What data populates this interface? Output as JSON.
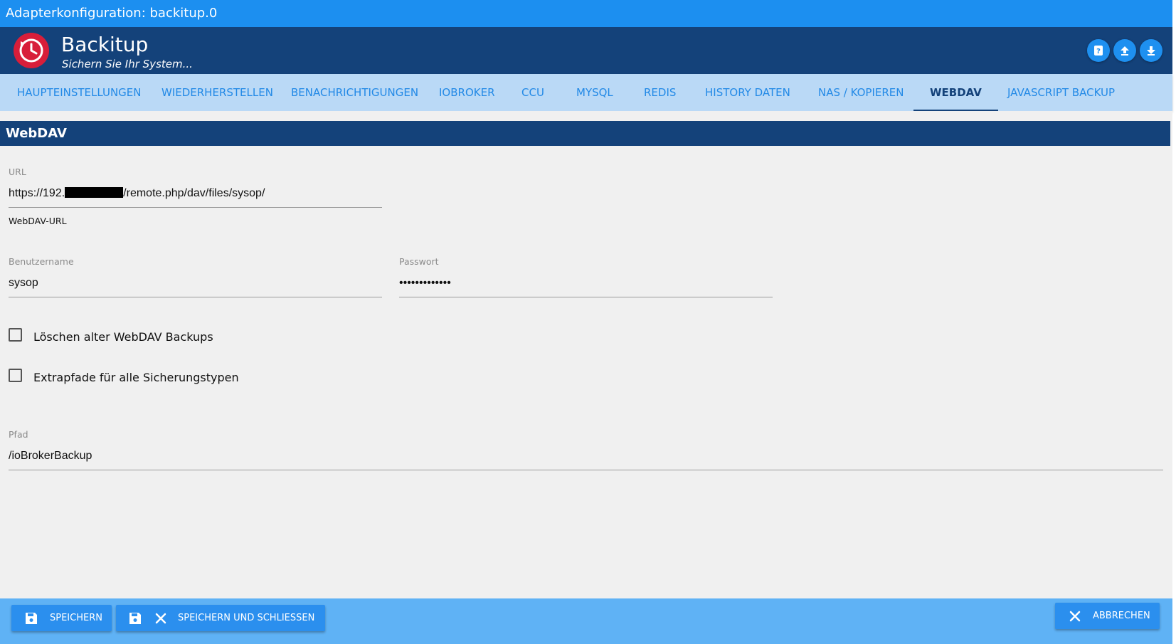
{
  "window": {
    "title": "Adapterkonfiguration: backitup.0"
  },
  "header": {
    "app_name": "Backitup",
    "subtitle": "Sichern Sie Ihr System...",
    "icons": [
      "backitup-logo-icon",
      "help-icon",
      "upload-icon",
      "download-icon"
    ]
  },
  "tabs": [
    {
      "label": "HAUPTEINSTELLUNGEN"
    },
    {
      "label": "WIEDERHERSTELLEN"
    },
    {
      "label": "BENACHRICHTIGUNGEN"
    },
    {
      "label": "IOBROKER"
    },
    {
      "label": "CCU"
    },
    {
      "label": "MYSQL"
    },
    {
      "label": "REDIS"
    },
    {
      "label": "HISTORY DATEN"
    },
    {
      "label": "NAS / KOPIEREN"
    },
    {
      "label": "WEBDAV",
      "active": true
    },
    {
      "label": "JAVASCRIPT BACKUP"
    }
  ],
  "section": {
    "title": "WebDAV"
  },
  "form": {
    "url": {
      "label": "URL",
      "value_start": "https://192.",
      "value_end": "/remote.php/dav/files/sysop/",
      "help": "WebDAV-URL"
    },
    "username": {
      "label": "Benutzername",
      "value": "sysop"
    },
    "password": {
      "label": "Passwort",
      "value": "•••••••••••••"
    },
    "delete_old": {
      "label": "Löschen alter WebDAV Backups",
      "checked": false
    },
    "extra_paths": {
      "label": "Extrapfade für alle Sicherungstypen",
      "checked": false
    },
    "path": {
      "label": "Pfad",
      "value": "/ioBrokerBackup"
    }
  },
  "footer": {
    "save_label": "SPEICHERN",
    "save_close_label": "SPEICHERN UND SCHLIESSEN",
    "cancel_label": "ABBRECHEN"
  },
  "colors": {
    "titlebar": "#1c8ff0",
    "header": "#14427a",
    "tabs_bg": "#bad9f6",
    "tab_text": "#2289e6",
    "logo_red": "#d81e3a",
    "footer_bg": "#5fb2f5",
    "button_bg": "#2b8fee"
  }
}
